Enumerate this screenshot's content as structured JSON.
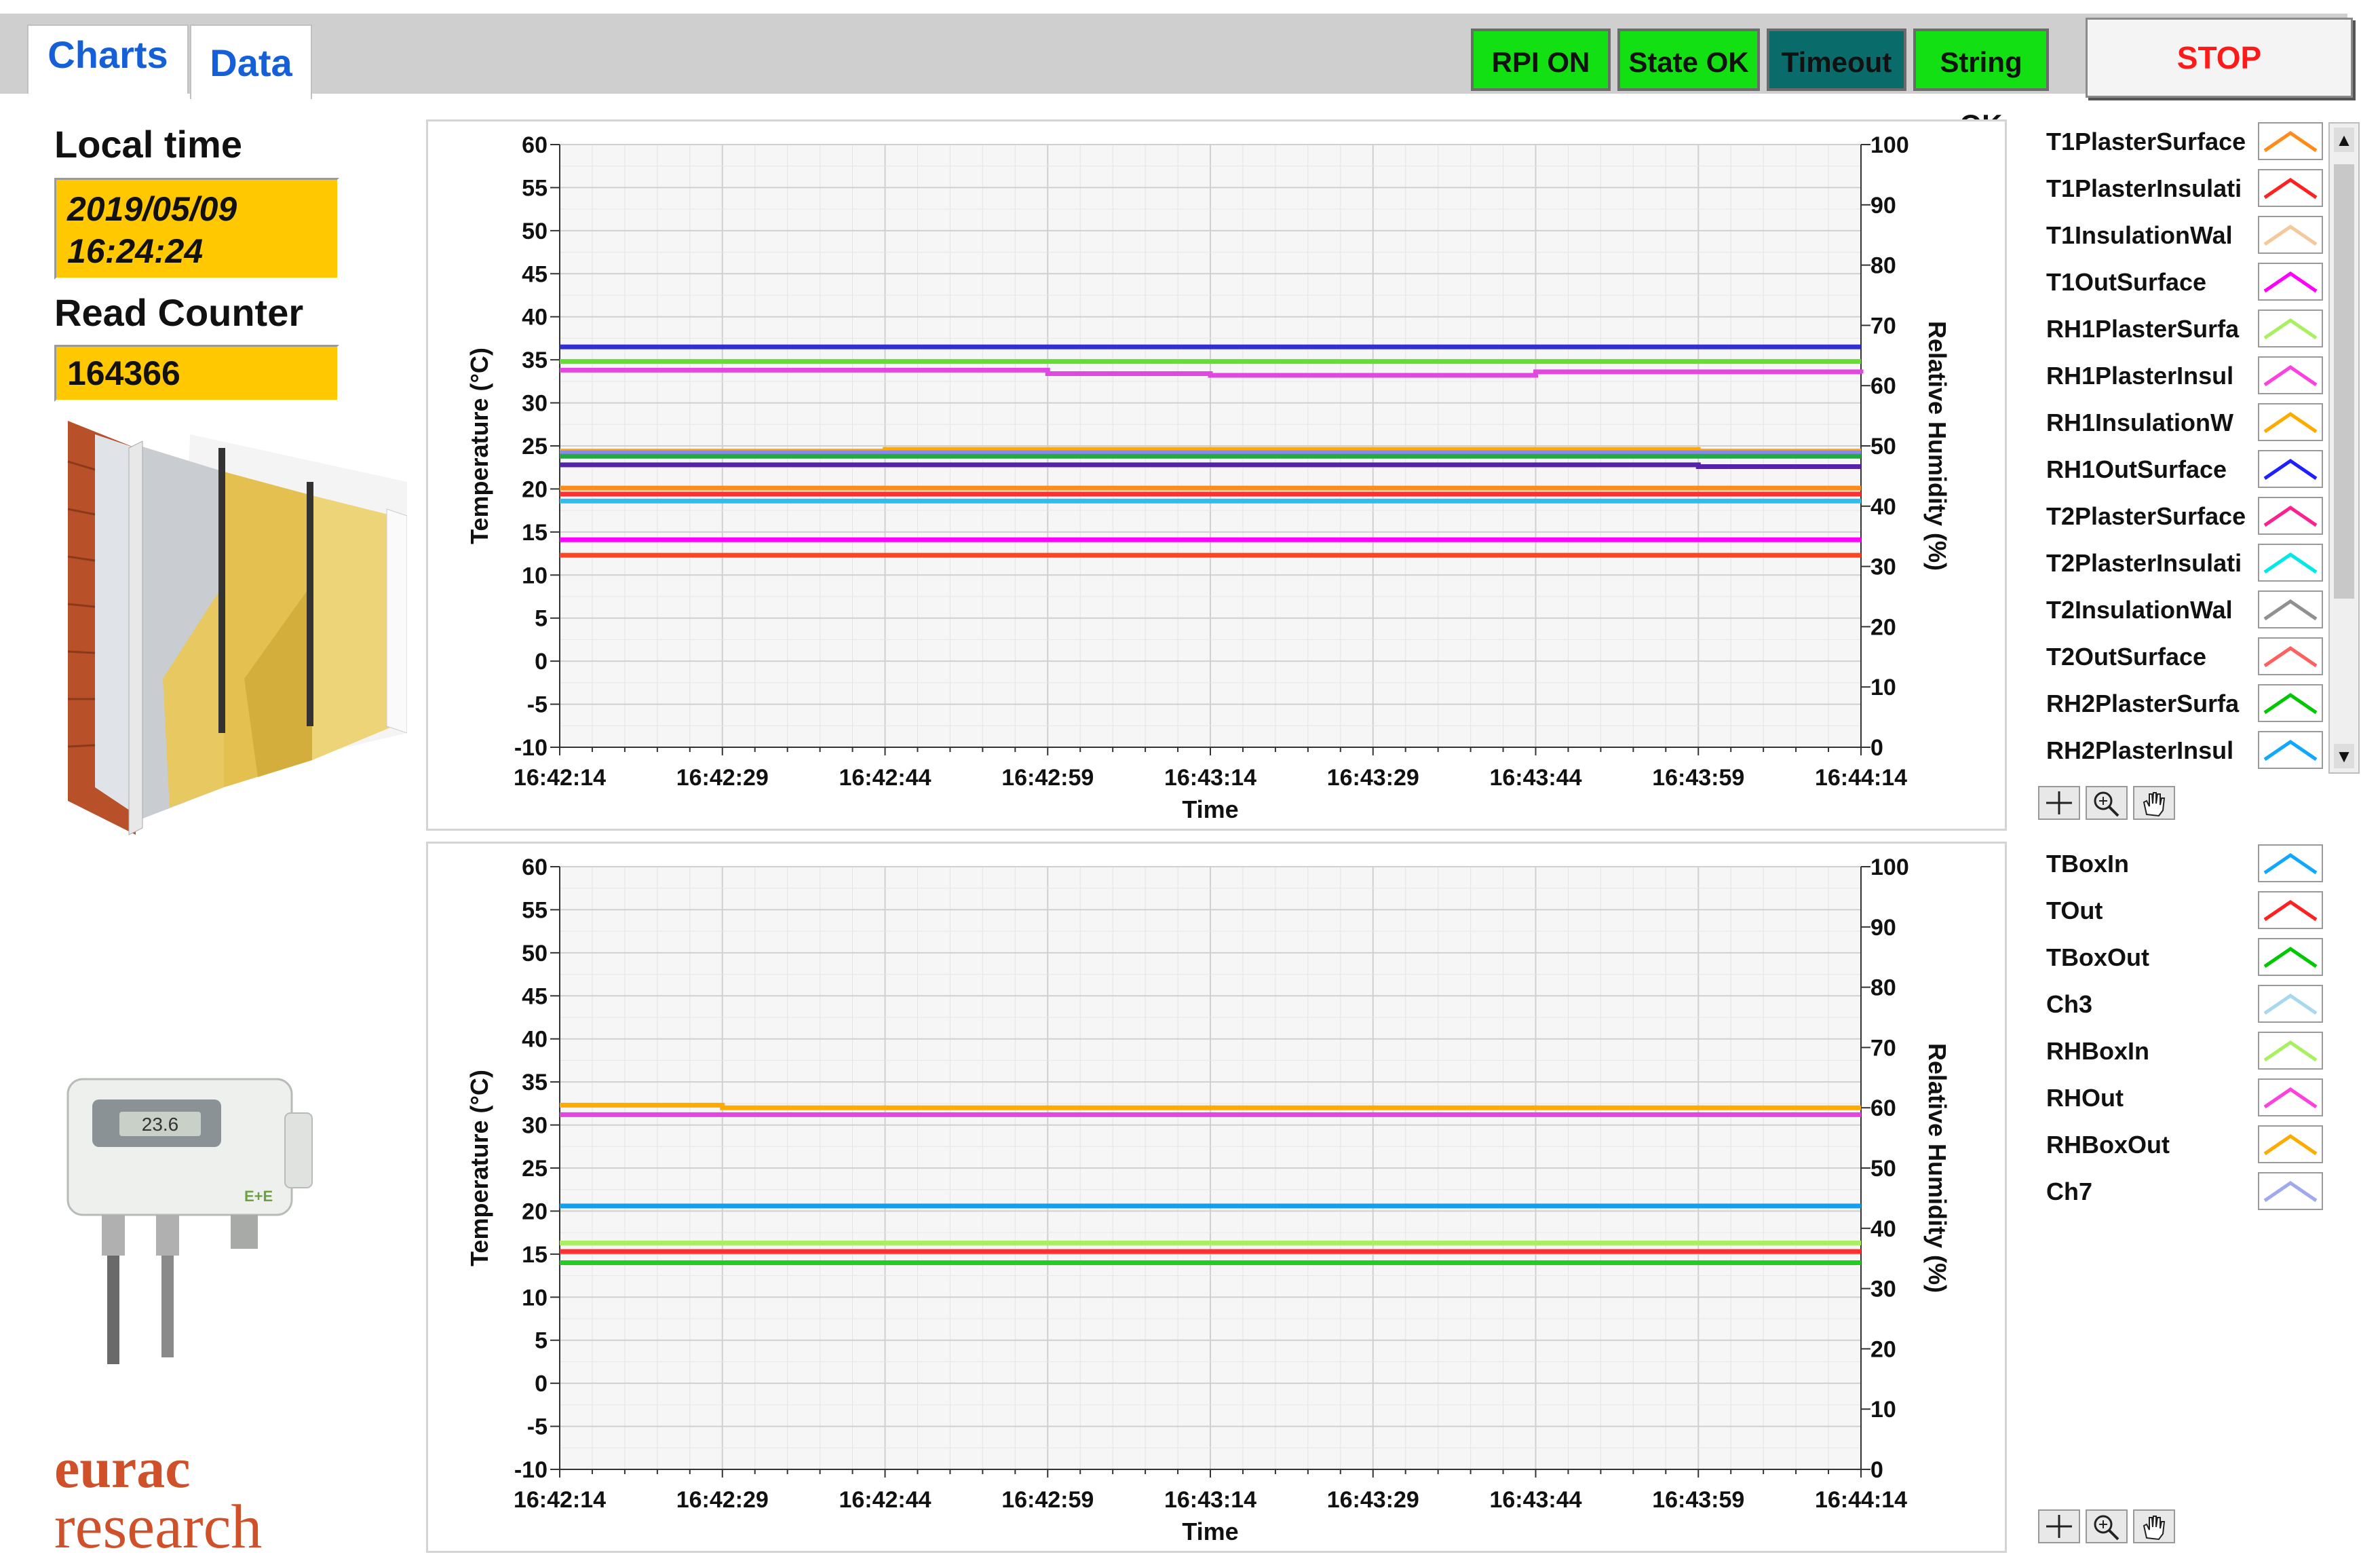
{
  "tabs": [
    {
      "label": "Charts"
    },
    {
      "label": "Data"
    }
  ],
  "indicators": {
    "rpi": {
      "label": "RPI ON",
      "color": "#12e012"
    },
    "state": {
      "label": "State OK",
      "color": "#12e012"
    },
    "timeout": {
      "label": "Timeout",
      "color": "#0a6b6b"
    },
    "string": {
      "label": "String OK",
      "color": "#12e012"
    }
  },
  "stop_label": "STOP",
  "left": {
    "local_time_label": "Local time",
    "date": "2019/05/09",
    "time": "16:24:24",
    "read_counter_label": "Read Counter",
    "read_counter": "164366",
    "logo_line1": "eurac",
    "logo_line2": "research",
    "sensor_display": "23.6"
  },
  "legend_top": [
    {
      "name": "T1PlasterSurface",
      "color": "#ff8c1a"
    },
    {
      "name": "T1PlasterInsulati",
      "color": "#ff2020"
    },
    {
      "name": "T1InsulationWal",
      "color": "#f5c89a"
    },
    {
      "name": "T1OutSurface",
      "color": "#ff00ff"
    },
    {
      "name": "RH1PlasterSurfa",
      "color": "#a8f060"
    },
    {
      "name": "RH1PlasterInsul",
      "color": "#ff40e0"
    },
    {
      "name": "RH1InsulationW",
      "color": "#ffaa00"
    },
    {
      "name": "RH1OutSurface",
      "color": "#2020ff"
    },
    {
      "name": "T2PlasterSurface",
      "color": "#ff2090"
    },
    {
      "name": "T2PlasterInsulati",
      "color": "#00e8e8"
    },
    {
      "name": "T2InsulationWal",
      "color": "#909090"
    },
    {
      "name": "T2OutSurface",
      "color": "#ff6060"
    },
    {
      "name": "RH2PlasterSurfa",
      "color": "#00c800"
    },
    {
      "name": "RH2PlasterInsul",
      "color": "#10a8ff"
    }
  ],
  "legend_bottom": [
    {
      "name": "TBoxIn",
      "color": "#10a8ff"
    },
    {
      "name": "TOut",
      "color": "#ff2020"
    },
    {
      "name": "TBoxOut",
      "color": "#00c800"
    },
    {
      "name": "Ch3",
      "color": "#a8d8f0"
    },
    {
      "name": "RHBoxIn",
      "color": "#a8f060"
    },
    {
      "name": "RHOut",
      "color": "#ff40e0"
    },
    {
      "name": "RHBoxOut",
      "color": "#ffaa00"
    },
    {
      "name": "Ch7",
      "color": "#a0a8f0"
    }
  ],
  "chart_data": [
    {
      "type": "line",
      "xlabel": "Time",
      "ylabel": "Temperature (°C)",
      "y2label": "Relative Humidity (%)",
      "ylim": [
        -10,
        60
      ],
      "y2lim": [
        0,
        100
      ],
      "yticks": [
        "60",
        "55",
        "50",
        "45",
        "40",
        "35",
        "30",
        "25",
        "20",
        "15",
        "10",
        "5",
        "0",
        "-5",
        "-10"
      ],
      "y2ticks": [
        "100",
        "90",
        "80",
        "70",
        "60",
        "50",
        "40",
        "30",
        "20",
        "10",
        "0"
      ],
      "xticks": [
        "16:42:14",
        "16:42:29",
        "16:42:44",
        "16:42:59",
        "16:43:14",
        "16:43:29",
        "16:43:44",
        "16:43:59",
        "16:44:14"
      ],
      "grid": true,
      "series": [
        {
          "name": "RH1OutSurface",
          "color": "#3030d0",
          "values": [
            36.5,
            36.5,
            36.5,
            36.5,
            36.5,
            36.5,
            36.5,
            36.5,
            36.5
          ]
        },
        {
          "name": "RH2PlasterSurfa",
          "color": "#66dd33",
          "values": [
            34.8,
            34.8,
            34.8,
            34.8,
            34.8,
            34.8,
            34.8,
            34.8,
            34.8
          ]
        },
        {
          "name": "RH1PlasterInsul",
          "color": "#e048e0",
          "values": [
            33.8,
            33.8,
            33.8,
            33.4,
            33.2,
            33.2,
            33.6,
            33.6,
            33.4
          ]
        },
        {
          "name": "RH1InsulationW",
          "color": "#ffaa00",
          "values": [
            24.4,
            24.4,
            24.6,
            24.6,
            24.6,
            24.6,
            24.6,
            24.4,
            24.4
          ]
        },
        {
          "name": "RH1PlasterSurfa",
          "color": "#8888ee",
          "values": [
            24.2,
            24.2,
            24.2,
            24.2,
            24.2,
            24.2,
            24.2,
            24.2,
            24.2
          ]
        },
        {
          "name": "RH2PlasterInsul",
          "color": "#22aa44",
          "values": [
            23.8,
            23.8,
            23.8,
            23.8,
            23.8,
            23.8,
            23.8,
            23.8,
            23.8
          ]
        },
        {
          "name": "T1OutSurface",
          "color": "#5522aa",
          "values": [
            22.8,
            22.8,
            22.8,
            22.8,
            22.8,
            22.8,
            22.8,
            22.6,
            22.6
          ]
        },
        {
          "name": "T1PlasterSurface",
          "color": "#ff8c1a",
          "values": [
            20.1,
            20.1,
            20.1,
            20.1,
            20.1,
            20.1,
            20.1,
            20.1,
            20.1
          ]
        },
        {
          "name": "T1PlasterInsulati",
          "color": "#ff3030",
          "values": [
            19.4,
            19.4,
            19.4,
            19.4,
            19.4,
            19.4,
            19.4,
            19.4,
            19.4
          ]
        },
        {
          "name": "T2PlasterInsulati",
          "color": "#33bbee",
          "values": [
            18.6,
            18.6,
            18.6,
            18.6,
            18.6,
            18.6,
            18.6,
            18.6,
            18.6
          ]
        },
        {
          "name": "T2PlasterSurface",
          "color": "#ff00ff",
          "values": [
            14.1,
            14.1,
            14.1,
            14.1,
            14.1,
            14.1,
            14.1,
            14.1,
            14.1
          ]
        },
        {
          "name": "T2OutSurface",
          "color": "#ff4422",
          "values": [
            12.3,
            12.3,
            12.3,
            12.3,
            12.3,
            12.3,
            12.3,
            12.3,
            12.3
          ]
        }
      ]
    },
    {
      "type": "line",
      "xlabel": "Time",
      "ylabel": "Temperature (°C)",
      "y2label": "Relative Humidity (%)",
      "ylim": [
        -10,
        60
      ],
      "y2lim": [
        0,
        100
      ],
      "yticks": [
        "60",
        "55",
        "50",
        "45",
        "40",
        "35",
        "30",
        "25",
        "20",
        "15",
        "10",
        "5",
        "0",
        "-5",
        "-10"
      ],
      "y2ticks": [
        "100",
        "90",
        "80",
        "70",
        "60",
        "50",
        "40",
        "30",
        "20",
        "10",
        "0"
      ],
      "xticks": [
        "16:42:14",
        "16:42:29",
        "16:42:44",
        "16:42:59",
        "16:43:14",
        "16:43:29",
        "16:43:44",
        "16:43:59",
        "16:44:14"
      ],
      "grid": true,
      "series": [
        {
          "name": "RHBoxOut",
          "color": "#ffaa00",
          "values": [
            32.3,
            32.0,
            32.0,
            32.0,
            32.0,
            32.0,
            32.0,
            32.0,
            32.0
          ]
        },
        {
          "name": "RHOut",
          "color": "#e048e0",
          "values": [
            31.2,
            31.2,
            31.2,
            31.2,
            31.2,
            31.2,
            31.2,
            31.2,
            31.2
          ]
        },
        {
          "name": "TBoxIn",
          "color": "#10a0f0",
          "values": [
            20.6,
            20.6,
            20.6,
            20.6,
            20.6,
            20.6,
            20.6,
            20.6,
            20.6
          ]
        },
        {
          "name": "RHBoxIn",
          "color": "#a8f060",
          "values": [
            16.3,
            16.3,
            16.3,
            16.3,
            16.3,
            16.3,
            16.3,
            16.3,
            16.3
          ]
        },
        {
          "name": "TOut",
          "color": "#ff3030",
          "values": [
            15.3,
            15.3,
            15.3,
            15.3,
            15.3,
            15.3,
            15.3,
            15.3,
            15.3
          ]
        },
        {
          "name": "TBoxOut",
          "color": "#22cc22",
          "values": [
            14.0,
            14.0,
            14.0,
            14.0,
            14.0,
            14.0,
            14.0,
            14.0,
            14.0
          ]
        }
      ]
    }
  ]
}
